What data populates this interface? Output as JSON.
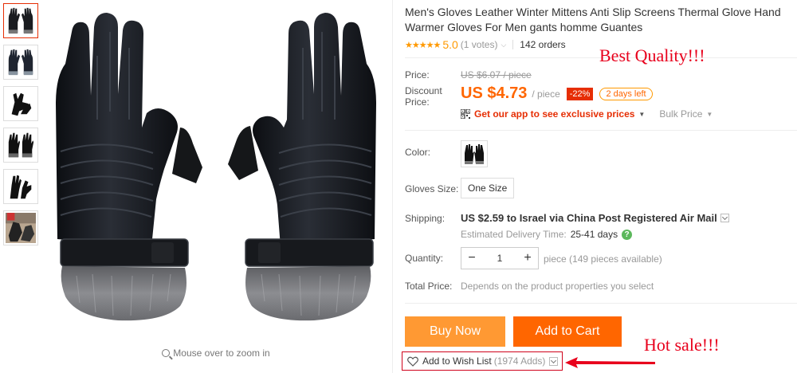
{
  "title": "Men's Gloves Leather Winter Mittens Anti Slip Screens Thermal Glove Hand Warmer Gloves For Men gants homme Guantes",
  "rating": {
    "stars": "★★★★★",
    "score": "5.0",
    "votes": "(1 votes)",
    "orders": "142 orders"
  },
  "price": {
    "price_label": "Price:",
    "original": "US $6.07 / piece",
    "discount_label": "Discount Price:",
    "discount_value": "US $4.73",
    "per_unit": "/ piece",
    "discount_pct": "-22%",
    "days_left": "2 days left",
    "app_promo": "Get our app to see exclusive prices",
    "bulk_price": "Bulk Price"
  },
  "sku": {
    "color_label": "Color:",
    "size_label": "Gloves Size:",
    "size_option": "One Size"
  },
  "shipping": {
    "label": "Shipping:",
    "main": "US $2.59 to Israel via China Post Registered Air Mail",
    "est_label": "Estimated Delivery Time:",
    "est_value": "25-41 days",
    "help": "?"
  },
  "quantity": {
    "label": "Quantity:",
    "minus": "−",
    "value": "1",
    "plus": "+",
    "available": "piece (149 pieces available)"
  },
  "total": {
    "label": "Total Price:",
    "value": "Depends on the product properties you select"
  },
  "actions": {
    "buy_now": "Buy Now",
    "add_to_cart": "Add to Cart",
    "wish_label": "Add to Wish List",
    "wish_count": "(1974 Adds)"
  },
  "image": {
    "zoom_hint": "Mouse over to zoom in"
  },
  "annotations": {
    "best_quality": "Best Quality!!!",
    "hot_sale": "Hot sale!!!"
  },
  "colors": {
    "discount_price": "#ff6600",
    "buy_now": "#ff9933",
    "add_to_cart": "#ff6600",
    "annotation": "#e8001c",
    "badge": "#e62e04"
  },
  "icons": [
    "magnifier-icon",
    "qr-code-icon",
    "dropdown-icon",
    "help-icon",
    "heart-icon",
    "arrow-icon"
  ]
}
